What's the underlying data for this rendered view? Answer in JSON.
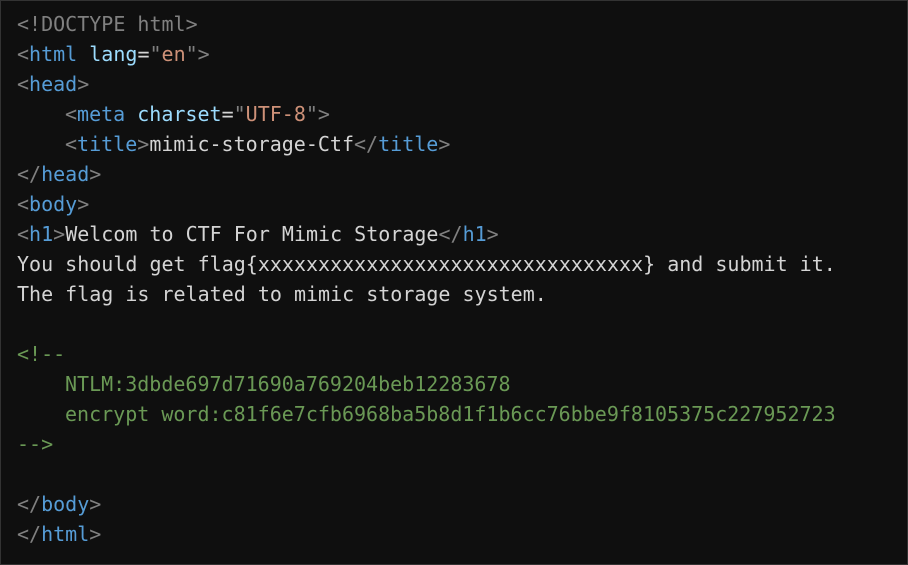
{
  "code": {
    "doctype_open": "<!",
    "doctype_text": "DOCTYPE html",
    "doctype_close": ">",
    "html_open_lt": "<",
    "html_tag": "html",
    "lang_attr": "lang",
    "eq": "=",
    "q": "\"",
    "lang_val": "en",
    "close_gt": ">",
    "head_tag": "head",
    "meta_tag": "meta",
    "charset_attr": "charset",
    "charset_val": "UTF-8",
    "title_tag": "title",
    "title_text": "mimic-storage-Ctf",
    "close_slash_lt": "</",
    "body_tag": "body",
    "h1_tag": "h1",
    "h1_text": "Welcom to CTF For Mimic Storage",
    "body_line1": "You should get flag{xxxxxxxxxxxxxxxxxxxxxxxxxxxxxxxx} and submit it.",
    "body_line2": "The flag is related to mimic storage system.",
    "comment_open": "<!--",
    "comment_line1": "NTLM:3dbde697d71690a769204beb12283678",
    "comment_line2": "encrypt word:c81f6e7cfb6968ba5b8d1f1b6cc76bbe9f8105375c227952723",
    "comment_close": "-->"
  }
}
